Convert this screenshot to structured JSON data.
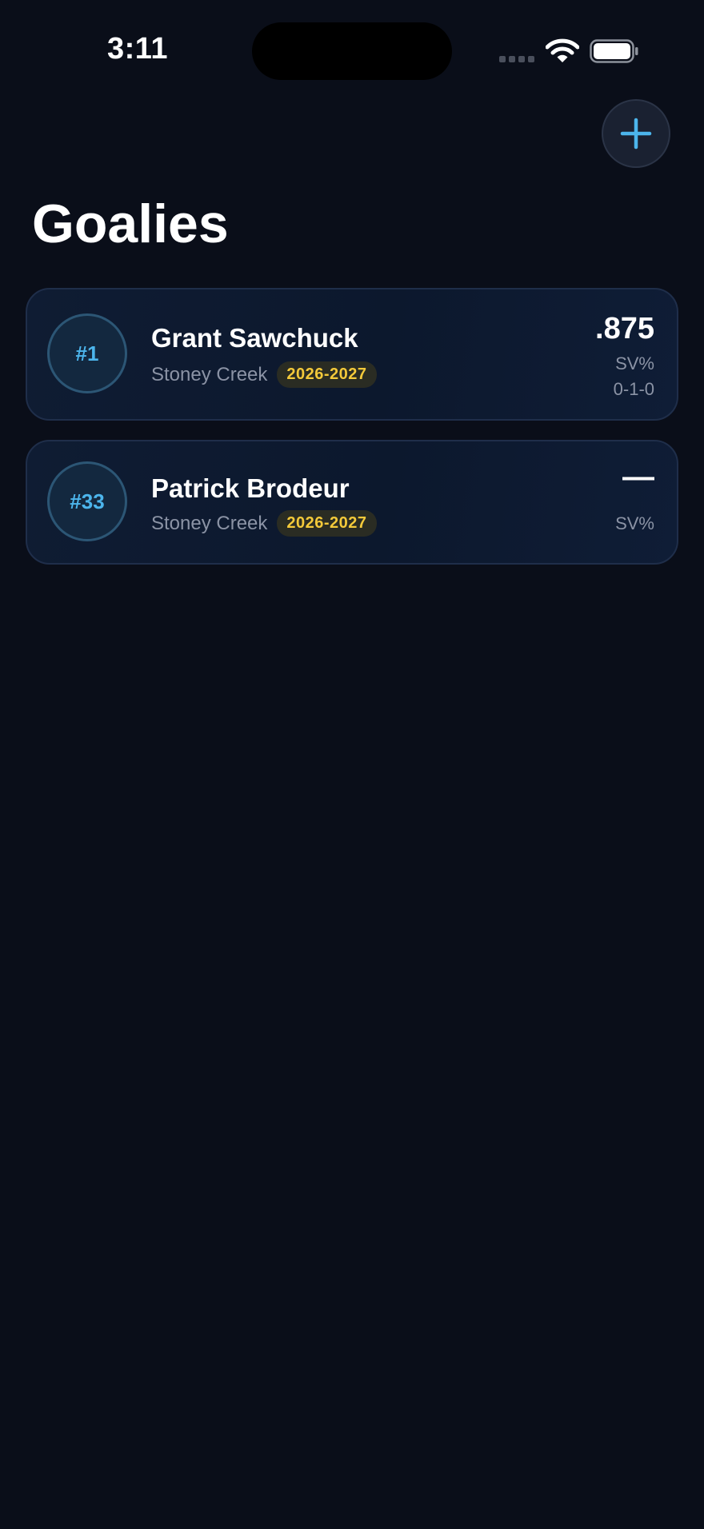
{
  "status_bar": {
    "time": "3:11"
  },
  "header": {
    "title": "Goalies",
    "add_button_icon": "plus-icon"
  },
  "colors": {
    "background": "#0a0e19",
    "accent": "#4cb5ec",
    "badge_text": "#f3c93a",
    "card_border": "#1f2e4a"
  },
  "goalies": [
    {
      "number": "#1",
      "name": "Grant Sawchuck",
      "team": "Stoney Creek",
      "season": "2026-2027",
      "sv_pct": ".875",
      "sv_label": "SV%",
      "record": "0-1-0"
    },
    {
      "number": "#33",
      "name": "Patrick Brodeur",
      "team": "Stoney Creek",
      "season": "2026-2027",
      "sv_pct": "—",
      "sv_label": "SV%"
    }
  ]
}
